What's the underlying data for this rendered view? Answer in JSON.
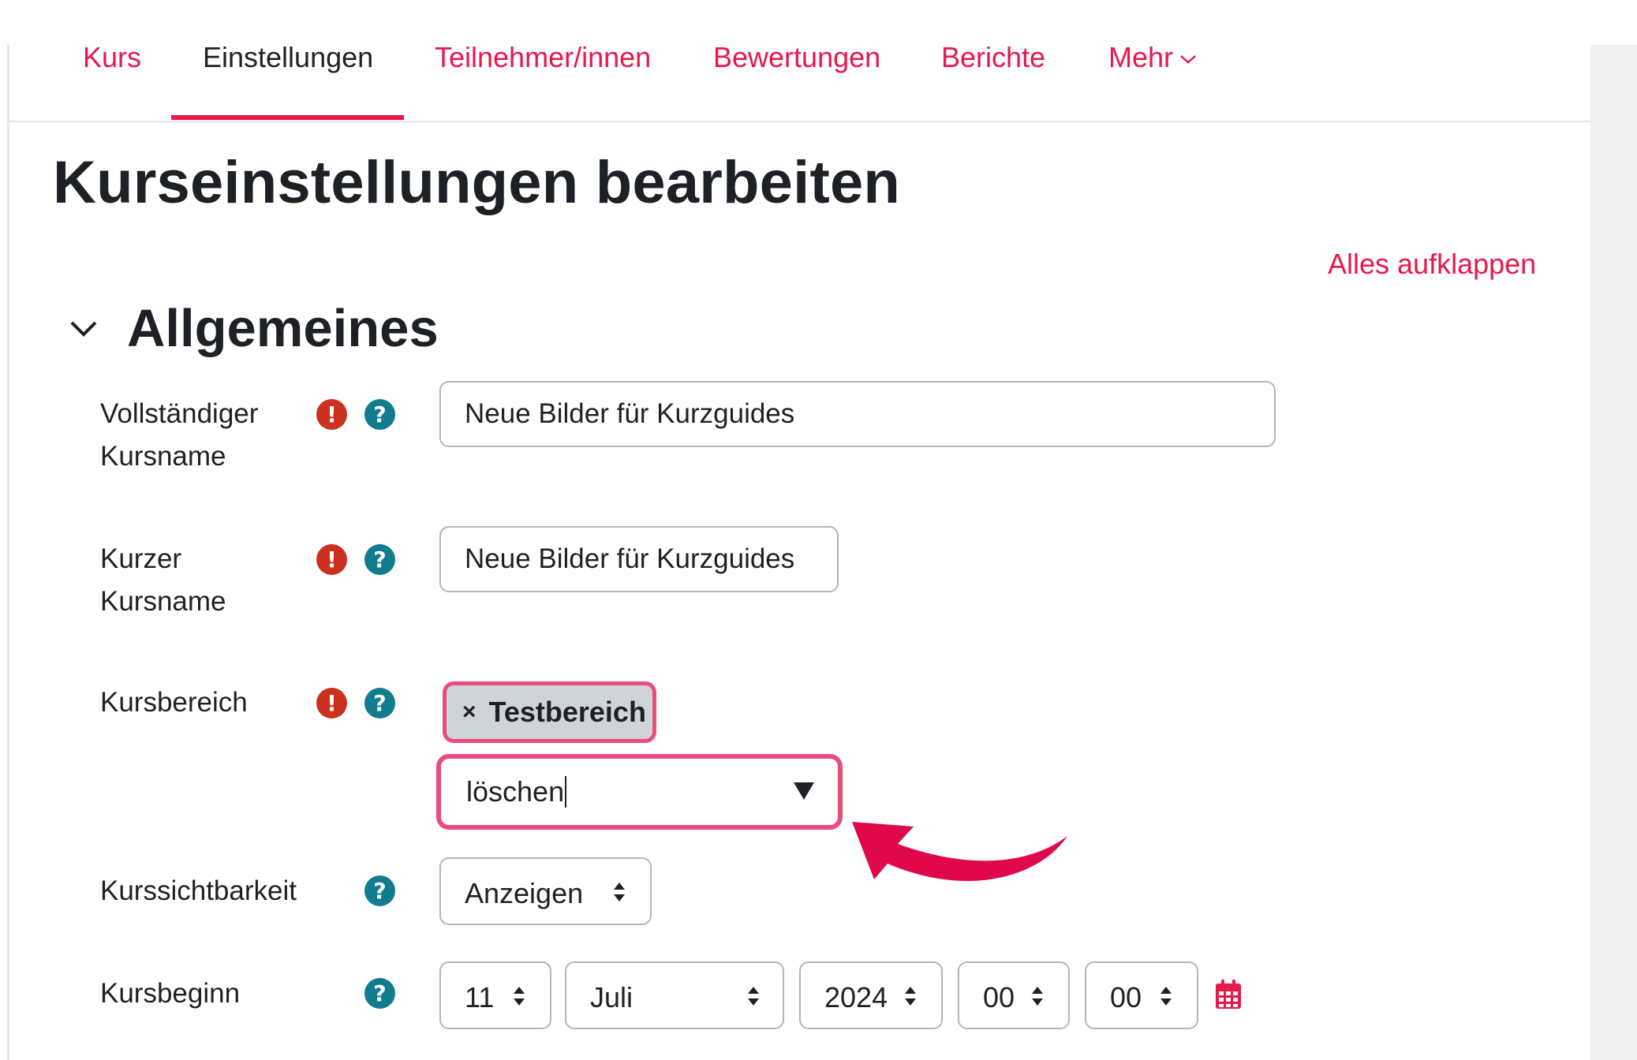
{
  "nav": {
    "items": [
      {
        "label": "Kurs",
        "active": false
      },
      {
        "label": "Einstellungen",
        "active": true
      },
      {
        "label": "Teilnehmer/innen",
        "active": false
      },
      {
        "label": "Bewertungen",
        "active": false
      },
      {
        "label": "Berichte",
        "active": false
      },
      {
        "label": "Mehr",
        "active": false
      }
    ]
  },
  "page": {
    "title": "Kurseinstellungen bearbeiten",
    "expand_all": "Alles aufklappen"
  },
  "section": {
    "title": "Allgemeines",
    "expanded": true
  },
  "form": {
    "fullname": {
      "label_line1": "Vollständiger",
      "label_line2": "Kursname",
      "value": "Neue Bilder für Kurzguides",
      "required": true
    },
    "shortname": {
      "label_line1": "Kurzer",
      "label_line2": "Kursname",
      "value": "Neue Bilder für Kurzguides",
      "required": true
    },
    "category": {
      "label": "Kursbereich",
      "selected_tag": "Testbereich",
      "tag_remove": "×",
      "search_value": "löschen",
      "required": true
    },
    "visibility": {
      "label": "Kurssichtbarkeit",
      "value": "Anzeigen"
    },
    "startdate": {
      "label": "Kursbeginn",
      "day": "11",
      "month": "Juli",
      "year": "2024",
      "hour": "00",
      "minute": "00"
    }
  },
  "icons": {
    "required": "exclamation-circle-icon",
    "help": "question-circle-icon",
    "calendar": "calendar-icon",
    "annotation": "curved-arrow-icon"
  },
  "colors": {
    "accent": "#e8174c",
    "highlight": "#ea4d7c",
    "required": "#ca3120",
    "help": "#127c8f",
    "tag_bg": "#ced4da",
    "annotation_arrow": "#e0084a"
  }
}
